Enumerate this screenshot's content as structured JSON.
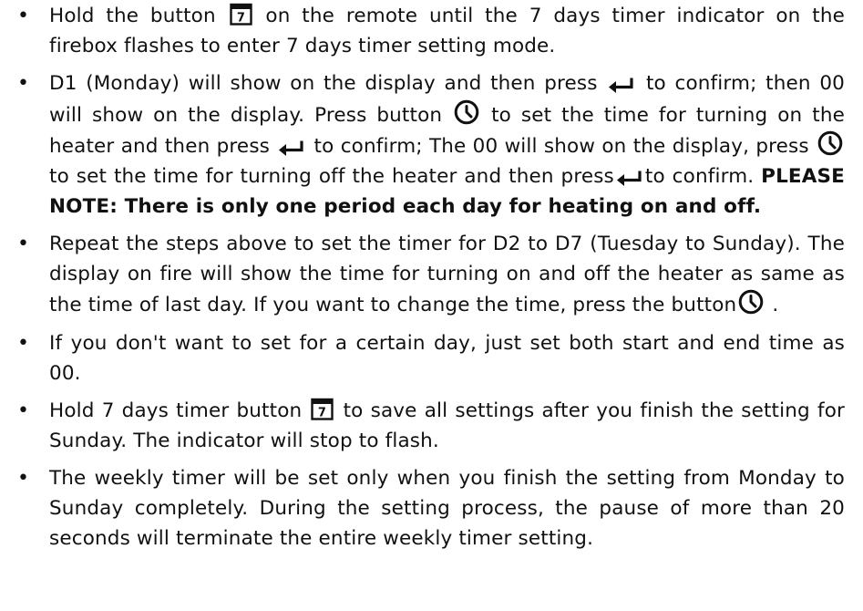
{
  "instructions": [
    {
      "parts": [
        {
          "t": "Hold the button "
        },
        {
          "icon": "calendar-7-icon"
        },
        {
          "t": " on the remote until the 7 days timer indicator on the firebox flashes to enter 7 days timer setting mode."
        }
      ]
    },
    {
      "parts": [
        {
          "t": "D1 (Monday) will show on the display and then press "
        },
        {
          "icon": "enter-arrow-icon"
        },
        {
          "t": " to confirm; then 00 will show on the display. Press button "
        },
        {
          "icon": "clock-icon"
        },
        {
          "t": " to set the time for turning on the heater and then press "
        },
        {
          "icon": "enter-arrow-icon"
        },
        {
          "t": " to confirm; The 00 will show on the display, press "
        },
        {
          "icon": "clock-icon"
        },
        {
          "t": " to set the time for turning off the heater and then press"
        },
        {
          "icon": "enter-arrow-icon"
        },
        {
          "t": "to confirm.  "
        },
        {
          "b": "PLEASE NOTE: There is only one period each day for heating on and off."
        }
      ]
    },
    {
      "parts": [
        {
          "t": "Repeat the steps above to set the timer for D2 to D7 (Tuesday to Sunday). The display on fire will show the time for turning on and off the heater as same as the time of last day. If you want to change the time, press the button"
        },
        {
          "icon": "clock-icon"
        },
        {
          "t": " ."
        }
      ]
    },
    {
      "parts": [
        {
          "t": "If you don't want to set for a certain day,  just set both start and end time as 00."
        }
      ]
    },
    {
      "parts": [
        {
          "t": "Hold 7 days timer button "
        },
        {
          "icon": "calendar-7-icon"
        },
        {
          "t": " to save all settings after you finish the setting for Sunday. The indicator will stop to flash."
        }
      ]
    },
    {
      "parts": [
        {
          "t": "The weekly timer will be set only when you finish the setting from Monday to Sunday completely. During the setting process, the pause of more than 20 seconds will terminate the entire weekly timer setting."
        }
      ]
    }
  ],
  "bullet_char": "•",
  "calendar_icon_digit": "7"
}
